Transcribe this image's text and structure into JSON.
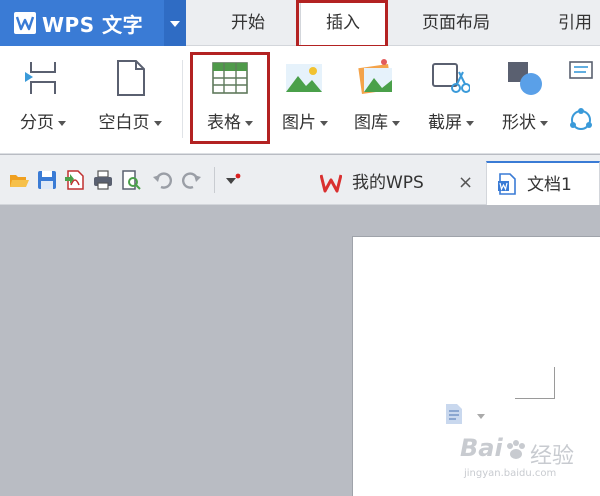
{
  "app": {
    "name": "WPS 文字",
    "logo_icon": "wps-w-logo-icon",
    "accent": "#3a7bd5"
  },
  "tabs": [
    {
      "label": "开始",
      "active": false
    },
    {
      "label": "插入",
      "active": true
    },
    {
      "label": "页面布局",
      "active": false
    },
    {
      "label": "引用",
      "active": false
    }
  ],
  "ribbon": {
    "page_break": "分页",
    "blank_page": "空白页",
    "table": "表格",
    "picture": "图片",
    "gallery": "图库",
    "screenshot": "截屏",
    "shapes": "形状"
  },
  "quickbar": {
    "icons": [
      "open-folder-icon",
      "save-icon",
      "export-pdf-icon",
      "print-icon",
      "print-preview-icon",
      "undo-icon",
      "redo-icon",
      "customize-icon"
    ]
  },
  "doc_tabs": [
    {
      "label": "我的WPS",
      "active": false,
      "close": "×"
    },
    {
      "label": "文档1",
      "active": true
    }
  ],
  "watermark": {
    "brand": "Bai",
    "cn": "经验",
    "url": "jingyan.baidu.com"
  },
  "highlight_color": "#b32222"
}
